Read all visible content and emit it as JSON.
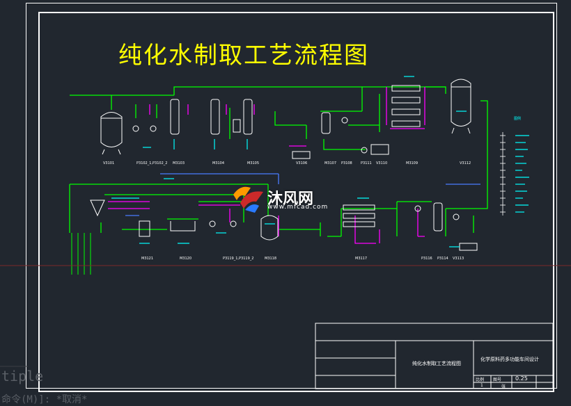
{
  "drawing": {
    "title": "纯化水制取工艺流程图",
    "top_row_tags": [
      "V3101",
      "P3102_1,P3102_2",
      "M3103",
      "M3104",
      "M3105",
      "V3106",
      "M3107",
      "P3108",
      "P3111",
      "V3110",
      "M3109",
      "V3112"
    ],
    "bottom_row_tags": [
      "M3121",
      "M3120",
      "P3119_1,P3119_2",
      "M3118",
      "M3117",
      "P3116",
      "P3114",
      "V3113"
    ],
    "side_legend_header": "图例"
  },
  "title_block": {
    "drawing_name": "纯化水制取工艺流程图",
    "project_name": "化学原料药多功能车间设计",
    "scale_label": "比例",
    "scale_value": "0.25",
    "sheet_label": "图号",
    "sheet_num": "1",
    "sheet_total": "张"
  },
  "watermark": {
    "brand": "沐风网",
    "url": "www.mfcad.com"
  },
  "command_line": {
    "ghost_text": "tiple",
    "prompt_text": "命令(M)]: *取消*"
  },
  "colors": {
    "background": "#21272f",
    "pipe_green": "#00ff00",
    "equipment_white": "#ffffff",
    "label_cyan": "#00ffff",
    "accent_magenta": "#ff00ff",
    "title_yellow": "#ffff00",
    "accent_blue": "#4a7cff"
  }
}
